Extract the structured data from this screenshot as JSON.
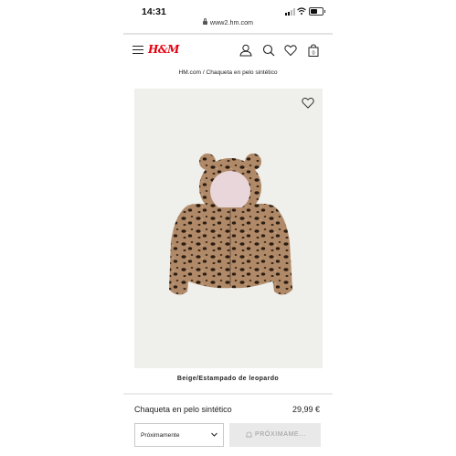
{
  "status_bar": {
    "time": "14:31"
  },
  "browser": {
    "url": "www2.hm.com"
  },
  "header": {
    "logo": "H&M"
  },
  "breadcrumb": "HM.com / Chaqueta en pelo sintético",
  "product": {
    "color_label": "Beige/Estampado de leopardo",
    "name": "Chaqueta en pelo sintético",
    "price": "29,99 €"
  },
  "purchase": {
    "size_select_value": "Próximamente",
    "notify_button_label": "PRÓXIMAME..."
  },
  "colors": {
    "brand_red": "#e50010",
    "image_background": "#efefec",
    "button_disabled_bg": "#e9e9e9"
  },
  "icons": [
    "menu-icon",
    "user-icon",
    "search-icon",
    "heart-icon",
    "bag-icon",
    "favorite-heart-icon",
    "chevron-down-icon",
    "bell-icon",
    "lock-icon"
  ]
}
